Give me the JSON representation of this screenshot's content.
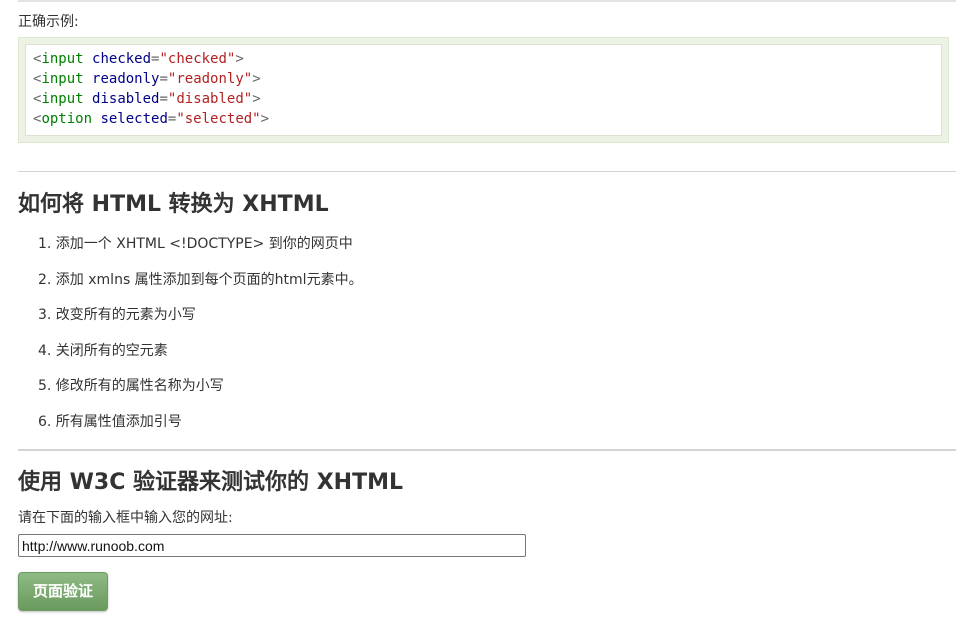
{
  "example": {
    "label": "正确示例:",
    "lines": [
      {
        "tag": "input",
        "attr": "checked",
        "value": "\"checked\""
      },
      {
        "tag": "input",
        "attr": "readonly",
        "value": "\"readonly\""
      },
      {
        "tag": "input",
        "attr": "disabled",
        "value": "\"disabled\""
      },
      {
        "tag": "option",
        "attr": "selected",
        "value": "\"selected\""
      }
    ]
  },
  "section_convert": {
    "title": "如何将 HTML 转换为 XHTML",
    "steps": [
      "1. 添加一个 XHTML <!DOCTYPE> 到你的网页中",
      "2. 添加 xmlns 属性添加到每个页面的html元素中。",
      "3. 改变所有的元素为小写",
      "4. 关闭所有的空元素",
      "5. 修改所有的属性名称为小写",
      "6. 所有属性值添加引号"
    ]
  },
  "section_validate": {
    "title": "使用 W3C 验证器来测试你的 XHTML",
    "prompt": "请在下面的输入框中输入您的网址:",
    "url_value": "http://www.runoob.com",
    "button_label": "页面验证"
  }
}
